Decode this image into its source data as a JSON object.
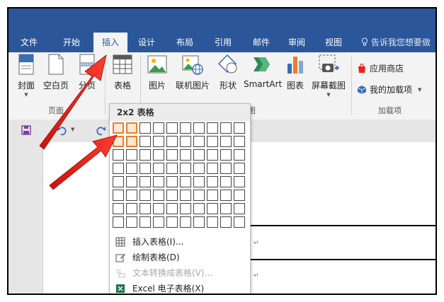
{
  "tabs": [
    "文件",
    "开始",
    "插入",
    "设计",
    "布局",
    "引用",
    "邮件",
    "审阅",
    "视图"
  ],
  "tell_me": "告诉我您想要做",
  "ribbon": {
    "cover": "封面",
    "blank_page": "空白页",
    "page_break": "分页",
    "table": "表格",
    "picture": "图片",
    "online_picture": "联机图片",
    "shapes": "形状",
    "smartart": "SmartArt",
    "chart": "图表",
    "screenshot": "屏幕截图",
    "store": "应用商店",
    "my_addins": "我的加载项",
    "group_pages": "页面",
    "group_illustrations": "图",
    "group_addins": "加载项"
  },
  "dropdown": {
    "title": "2x2 表格",
    "rows": 8,
    "cols": 10,
    "selected_rows": 2,
    "selected_cols": 2,
    "items": [
      {
        "label": "插入表格(I)...",
        "disabled": false
      },
      {
        "label": "绘制表格(D)",
        "disabled": false
      },
      {
        "label": "文本转换成表格(V)...",
        "disabled": true
      },
      {
        "label": "Excel 电子表格(X)",
        "disabled": false
      }
    ]
  },
  "paragraph_mark": "↵",
  "colors": {
    "accent": "#2b579a",
    "selection": "#e97e2d",
    "arrow": "#e8231b"
  }
}
